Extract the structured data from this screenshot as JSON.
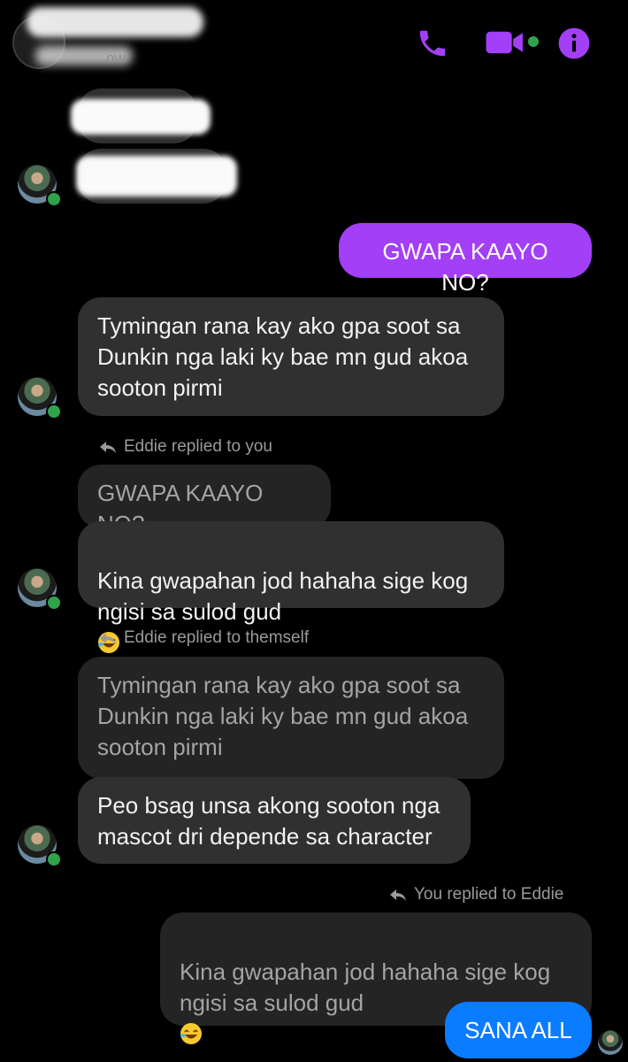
{
  "header": {
    "status_text": "ow",
    "icons": [
      "call-icon",
      "video-call-icon",
      "info-icon"
    ],
    "accent_color": "#a33ff6",
    "active_color": "#31a24c"
  },
  "messages": {
    "m1_text": "GWAPA KAAYO NO?",
    "m2_text": "Tymingan rana kay  ako gpa soot sa\nDunkin nga laki ky bae mn gud akoa\nsooton pirmi",
    "reply1_label": "Eddie replied to you",
    "reply1_quote": "GWAPA KAAYO NO?",
    "m3_text": "Kina gwapahan jod hahaha sige kog\nngisi sa sulod gud",
    "reply2_label": "Eddie replied to themself",
    "reply2_quote": "Tymingan rana kay  ako gpa soot sa\nDunkin nga laki ky bae mn gud akoa\nsooton pirmi",
    "m4_text": "Peo bsag unsa akong sooton nga\nmascot dri depende sa character",
    "reply3_label": "You replied to Eddie",
    "reply3_quote": "Kina gwapahan jod hahaha sige kog\nngisi sa sulod gud",
    "m5_text": "SANA ALL"
  },
  "colors": {
    "incoming_bubble": "#303030",
    "quoted_bubble": "#242424",
    "outgoing_purple": "#a33ff6",
    "outgoing_blue": "#0a7cff"
  }
}
